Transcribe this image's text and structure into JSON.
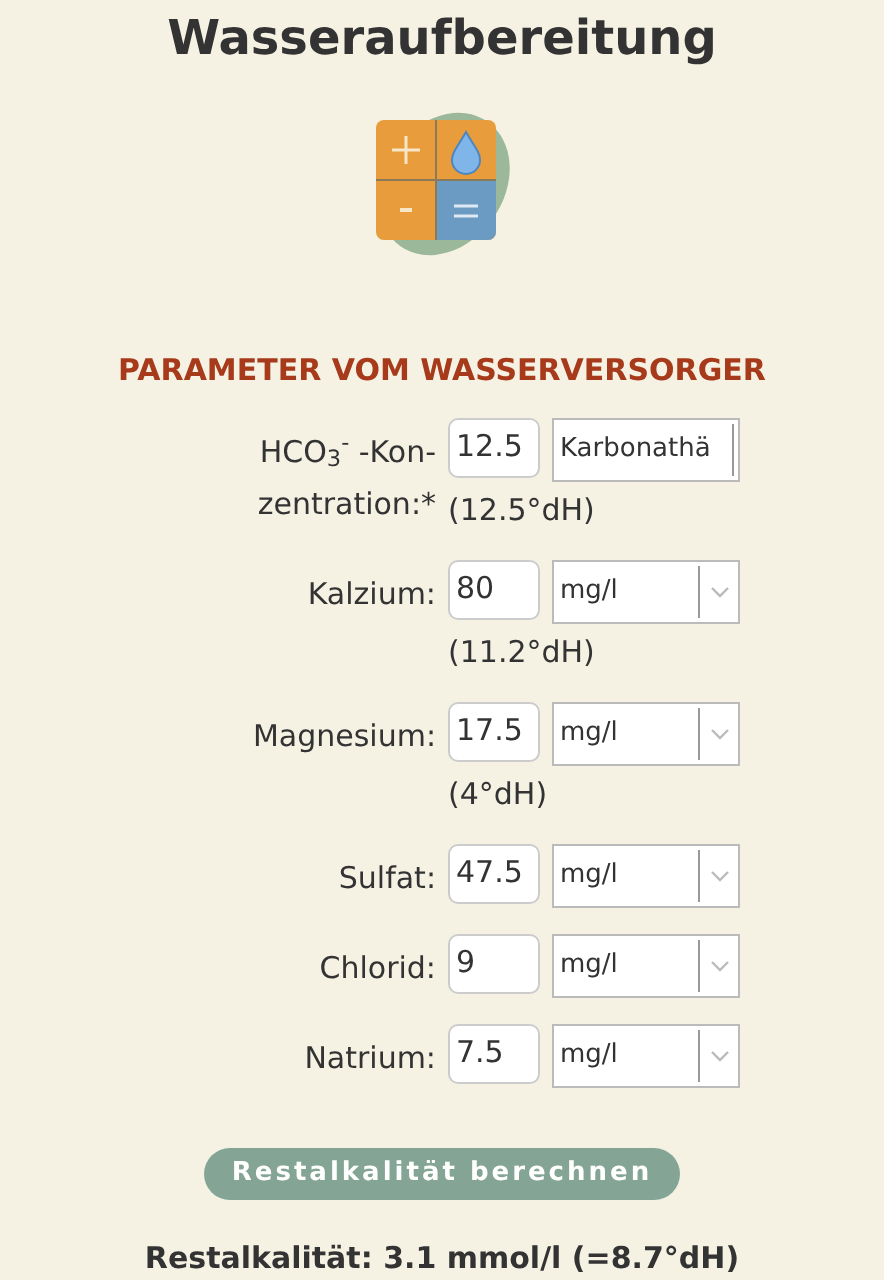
{
  "title": "Wasseraufbereitung",
  "section_heading": "PARAMETER VOM WASSERVERSORGER",
  "parameters": [
    {
      "label": "HCO$_{3}$$^{-}$ -Kon-zentration:*",
      "value": "12.5",
      "unit": "Karbonathä",
      "chevron": false,
      "note": "(12.5°dH)"
    },
    {
      "label": "Kalzium:",
      "value": "80",
      "unit": "mg/l",
      "chevron": true,
      "note": "(11.2°dH)"
    },
    {
      "label": "Magnesium:",
      "value": "17.5",
      "unit": "mg/l",
      "chevron": true,
      "note": "(4°dH)"
    },
    {
      "label": "Sulfat:",
      "value": "47.5",
      "unit": "mg/l",
      "chevron": true
    },
    {
      "label": "Chlorid:",
      "value": "9",
      "unit": "mg/l",
      "chevron": true
    },
    {
      "label": "Natrium:",
      "value": "7.5",
      "unit": "mg/l",
      "chevron": true
    }
  ],
  "button": "Restalkalität berechnen",
  "result": "Restalkalität: 3.1 mmol/l (=8.7°dH)"
}
